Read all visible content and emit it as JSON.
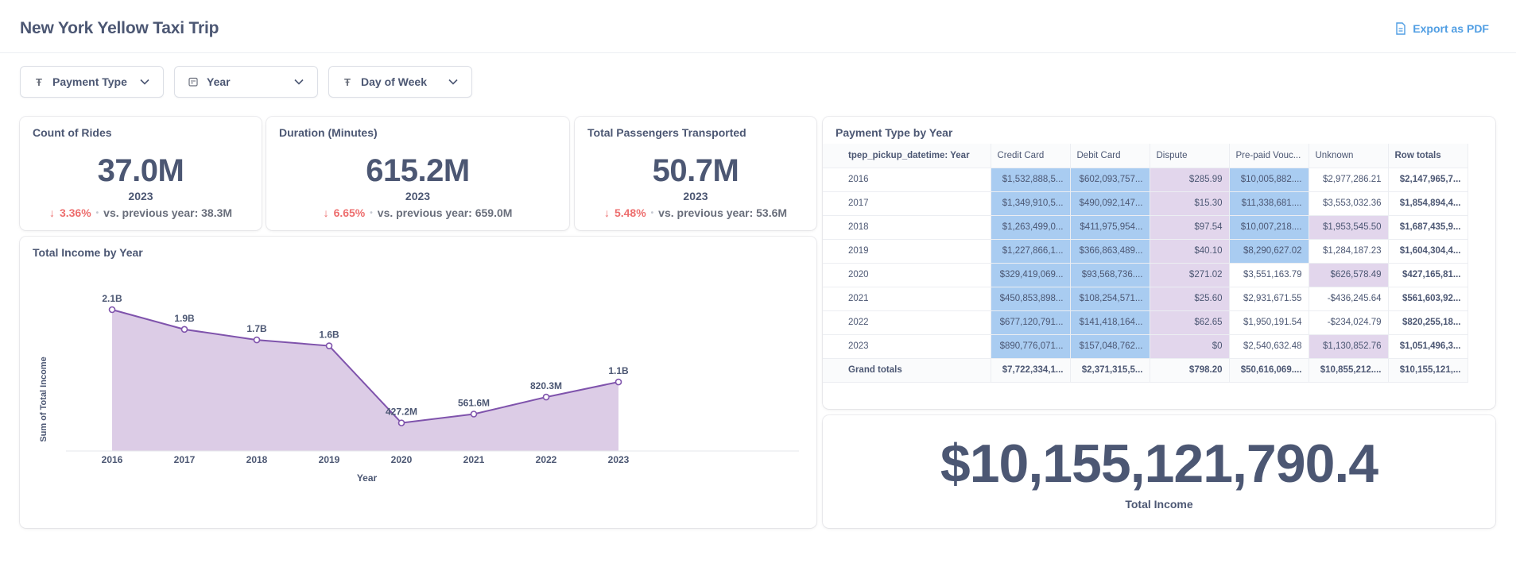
{
  "header": {
    "title": "New York Yellow Taxi Trip",
    "export_label": "Export as PDF"
  },
  "filters": [
    {
      "label": "Payment Type",
      "icon": "text-icon"
    },
    {
      "label": "Year",
      "icon": "calendar-icon"
    },
    {
      "label": "Day of Week",
      "icon": "text-icon"
    }
  ],
  "kpis": {
    "rides": {
      "title": "Count of Rides",
      "value": "37.0M",
      "year": "2023",
      "change": "3.36%",
      "previous": "vs. previous year: 38.3M"
    },
    "duration": {
      "title": "Duration (Minutes)",
      "value": "615.2M",
      "year": "2023",
      "change": "6.65%",
      "previous": "vs. previous year: 659.0M"
    },
    "passengers": {
      "title": "Total Passengers Transported",
      "value": "50.7M",
      "year": "2023",
      "change": "5.48%",
      "previous": "vs. previous year: 53.6M"
    }
  },
  "income_chart": {
    "title": "Total Income by Year",
    "colors": {
      "line": "#7f53ac",
      "area": "#dccce6"
    }
  },
  "chart_data": {
    "type": "area",
    "title": "Total Income by Year",
    "xlabel": "Year",
    "ylabel": "Sum of Total Income",
    "x": [
      "2016",
      "2017",
      "2018",
      "2019",
      "2020",
      "2021",
      "2022",
      "2023"
    ],
    "values": [
      2.15,
      1.85,
      1.69,
      1.6,
      0.4272,
      0.5616,
      0.8203,
      1.05
    ],
    "data_labels": [
      "2.1B",
      "1.9B",
      "1.7B",
      "1.6B",
      "427.2M",
      "561.6M",
      "820.3M",
      "1.1B"
    ],
    "units": "billions",
    "ylim": [
      0,
      2.15
    ],
    "grid": false
  },
  "pivot": {
    "title": "Payment Type by Year",
    "columns": [
      "tpep_pickup_datetime: Year",
      "Credit Card",
      "Debit Card",
      "Dispute",
      "Pre-paid Vouc...",
      "Unknown",
      "Row totals"
    ],
    "rows": [
      [
        "2016",
        "$1,532,888,5...",
        "$602,093,757...",
        "$285.99",
        "$10,005,882....",
        "$2,977,286.21",
        "$2,147,965,7..."
      ],
      [
        "2017",
        "$1,349,910,5...",
        "$490,092,147...",
        "$15.30",
        "$11,338,681....",
        "$3,553,032.36",
        "$1,854,894,4..."
      ],
      [
        "2018",
        "$1,263,499,0...",
        "$411,975,954...",
        "$97.54",
        "$10,007,218....",
        "$1,953,545.50",
        "$1,687,435,9..."
      ],
      [
        "2019",
        "$1,227,866,1...",
        "$366,863,489...",
        "$40.10",
        "$8,290,627.02",
        "$1,284,187.23",
        "$1,604,304,4..."
      ],
      [
        "2020",
        "$329,419,069...",
        "$93,568,736....",
        "$271.02",
        "$3,551,163.79",
        "$626,578.49",
        "$427,165,81..."
      ],
      [
        "2021",
        "$450,853,898...",
        "$108,254,571...",
        "$25.60",
        "$2,931,671.55",
        "-$436,245.64",
        "$561,603,92..."
      ],
      [
        "2022",
        "$677,120,791...",
        "$141,418,164...",
        "$62.65",
        "$1,950,191.54",
        "-$234,024.79",
        "$820,255,18..."
      ],
      [
        "2023",
        "$890,776,071...",
        "$157,048,762...",
        "$0",
        "$2,540,632.48",
        "$1,130,852.76",
        "$1,051,496,3..."
      ]
    ],
    "grand": [
      "Grand totals",
      "$7,722,334,1...",
      "$2,371,315,5...",
      "$798.20",
      "$50,616,069....",
      "$10,855,212....",
      "$10,155,121,..."
    ],
    "highlight": [
      [
        "",
        "blue",
        "blue",
        "purple",
        "blue",
        "",
        ""
      ],
      [
        "",
        "blue",
        "blue",
        "purple",
        "blue",
        "",
        ""
      ],
      [
        "",
        "blue",
        "blue",
        "purple",
        "blue",
        "purple",
        ""
      ],
      [
        "",
        "blue",
        "blue",
        "purple",
        "blue",
        "",
        ""
      ],
      [
        "",
        "blue",
        "blue",
        "purple",
        "",
        "purple",
        ""
      ],
      [
        "",
        "blue",
        "blue",
        "purple",
        "",
        "",
        ""
      ],
      [
        "",
        "blue",
        "blue",
        "purple",
        "",
        "",
        ""
      ],
      [
        "",
        "blue",
        "blue",
        "purple",
        "",
        "purple",
        ""
      ]
    ]
  },
  "total_income": {
    "value": "$10,155,121,790.4",
    "label": "Total Income"
  }
}
